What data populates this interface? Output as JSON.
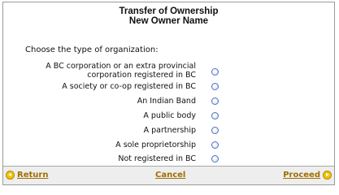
{
  "header": {
    "title_line1": "Transfer of Ownership",
    "title_line2": "New Owner Name"
  },
  "form": {
    "prompt": "Choose the type of organization:",
    "options": [
      {
        "label_line1": "A BC corporation or an extra provincial",
        "label_line2": "corporation registered in BC",
        "selected": false
      },
      {
        "label": "A society or co-op registered in BC",
        "selected": false
      },
      {
        "label": "An Indian Band",
        "selected": false
      },
      {
        "label": "A public body",
        "selected": false
      },
      {
        "label": "A partnership",
        "selected": false
      },
      {
        "label": "A sole proprietorship",
        "selected": false
      },
      {
        "label": "Not registered in BC",
        "selected": false
      }
    ]
  },
  "footer": {
    "return_label": "Return",
    "cancel_label": "Cancel",
    "proceed_label": "Proceed"
  },
  "colors": {
    "link": "#a06e00",
    "icon_fill": "#f1c500",
    "radio_border": "#4d72b8",
    "footer_bg": "#eeeeee"
  },
  "icons": {
    "return": "arrow-left-circle-icon",
    "proceed": "arrow-right-circle-icon"
  }
}
